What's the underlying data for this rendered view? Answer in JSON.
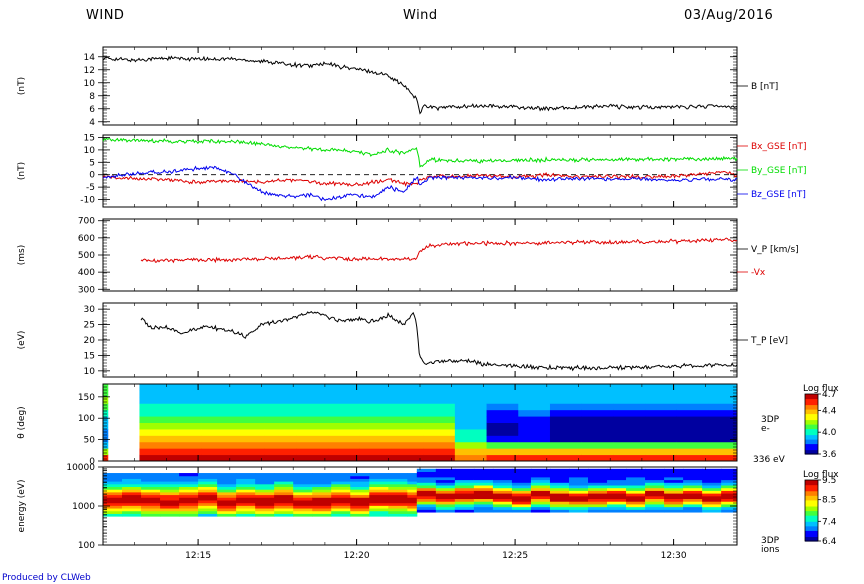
{
  "header": {
    "left": "WIND",
    "center": "Wind",
    "right": "03/Aug/2016"
  },
  "footer": {
    "credit": "Produced by CLWeb"
  },
  "colors": {
    "black": "#000000",
    "red": "#dd0000",
    "green": "#00dd00",
    "blue": "#0000ee",
    "spectrogram_scale": [
      "#0000a0",
      "#0000ff",
      "#0080ff",
      "#00c0ff",
      "#00ffc0",
      "#40ff40",
      "#a0ff00",
      "#ffff00",
      "#ffc000",
      "#ff8000",
      "#ff2000",
      "#c00000"
    ]
  },
  "chart_data": [
    {
      "type": "line",
      "ylabel": "(nT)",
      "ylim": [
        3.5,
        15.5
      ],
      "yticks": [
        4,
        6,
        8,
        10,
        12,
        14
      ],
      "series": [
        {
          "name": "B [nT]",
          "color": "#000000",
          "x": [
            12.0,
            12.5,
            13.0,
            14.0,
            15.0,
            16.0,
            17.0,
            17.5,
            18.0,
            18.5,
            19.0,
            19.5,
            20.0,
            20.5,
            21.0,
            21.5,
            21.9,
            22.0,
            22.1,
            22.3,
            22.6,
            23.0,
            24.0,
            25.0,
            26.0,
            27.0,
            28.0,
            29.0,
            30.0,
            31.0,
            32.0
          ],
          "y": [
            13.8,
            13.6,
            13.5,
            13.8,
            13.6,
            13.7,
            13.3,
            13.1,
            12.8,
            12.6,
            12.9,
            12.5,
            12.1,
            11.6,
            11.2,
            9.5,
            7.5,
            5.2,
            6.6,
            6.3,
            6.1,
            6.3,
            6.4,
            6.3,
            6.0,
            6.2,
            6.4,
            6.2,
            6.3,
            6.4,
            6.4
          ]
        }
      ],
      "legend": [
        {
          "label": "B [nT]",
          "color": "#000000"
        }
      ]
    },
    {
      "type": "line",
      "ylabel": "(nT)",
      "ylim": [
        -13,
        16
      ],
      "yticks": [
        -10,
        -5,
        0,
        5,
        10,
        15
      ],
      "zero_line": 0,
      "series": [
        {
          "name": "Bx_GSE [nT]",
          "color": "#dd0000",
          "x": [
            12.0,
            13.0,
            14.0,
            15.0,
            16.0,
            17.0,
            18.0,
            19.0,
            20.0,
            20.5,
            21.0,
            21.5,
            21.9,
            22.0,
            22.3,
            23.0,
            24.0,
            25.0,
            26.0,
            27.0,
            28.0,
            29.0,
            30.0,
            31.0,
            31.6,
            32.0
          ],
          "y": [
            -1,
            -1.5,
            -2,
            -3,
            -2.5,
            -3,
            -2,
            -3.5,
            -4,
            -3,
            -2,
            -3.5,
            -4,
            -2,
            -1,
            -0.5,
            -0.5,
            -0.8,
            0,
            -1,
            -0.5,
            -0.8,
            -0.5,
            0.5,
            1.5,
            -0.5
          ]
        },
        {
          "name": "By_GSE [nT]",
          "color": "#00dd00",
          "x": [
            12.0,
            13.0,
            14.0,
            15.0,
            16.0,
            16.5,
            17.0,
            17.5,
            18.0,
            18.5,
            19.0,
            19.5,
            20.0,
            20.5,
            21.0,
            21.5,
            21.9,
            22.0,
            22.3,
            23.0,
            24.0,
            25.0,
            26.0,
            27.0,
            28.0,
            29.0,
            30.0,
            31.0,
            32.0
          ],
          "y": [
            14,
            14,
            13.5,
            13.5,
            13.5,
            13,
            12.5,
            11.5,
            11,
            10.5,
            10,
            10,
            9.5,
            8,
            10,
            8.5,
            11,
            3.5,
            6,
            5.5,
            5.5,
            5.8,
            6,
            6,
            6,
            6.2,
            6.3,
            6.4,
            6.5
          ]
        },
        {
          "name": "Bz_GSE [nT]",
          "color": "#0000ee",
          "x": [
            12.0,
            13.0,
            14.0,
            15.0,
            15.5,
            16.0,
            16.5,
            17.0,
            17.5,
            18.0,
            18.5,
            19.0,
            19.5,
            20.0,
            20.5,
            21.0,
            21.5,
            21.9,
            22.0,
            22.3,
            23.0,
            24.0,
            25.0,
            26.0,
            27.0,
            28.0,
            29.0,
            30.0,
            31.0,
            32.0
          ],
          "y": [
            -1,
            0.5,
            1,
            2.5,
            3,
            1,
            -3,
            -7,
            -8,
            -9,
            -8,
            -10,
            -9,
            -8,
            -9,
            -5,
            -7,
            -1,
            -4,
            -1.5,
            -1,
            -1.5,
            -1,
            -2,
            -1.5,
            -2,
            -1.5,
            -2.5,
            -1.5,
            -2
          ]
        }
      ],
      "legend": [
        {
          "label": "Bx_GSE [nT]",
          "color": "#dd0000"
        },
        {
          "label": "By_GSE [nT]",
          "color": "#00dd00"
        },
        {
          "label": "Bz_GSE [nT]",
          "color": "#0000ee"
        }
      ]
    },
    {
      "type": "line",
      "ylabel": "(ms)",
      "ylim": [
        290,
        710
      ],
      "yticks": [
        300,
        400,
        500,
        600,
        700
      ],
      "series": [
        {
          "name": "V_P [km/s]",
          "color": "#dd0000",
          "x": [
            13.2,
            14.0,
            15.0,
            16.0,
            17.0,
            18.0,
            18.5,
            19.0,
            20.0,
            21.0,
            21.9,
            22.0,
            22.3,
            23.0,
            24.0,
            25.0,
            26.0,
            27.0,
            28.0,
            29.0,
            30.0,
            31.0,
            31.6,
            32.0
          ],
          "y": [
            467,
            468,
            470,
            472,
            478,
            482,
            490,
            480,
            476,
            478,
            476,
            520,
            555,
            565,
            568,
            568,
            570,
            575,
            572,
            578,
            580,
            584,
            590,
            585
          ]
        }
      ],
      "legend": [
        {
          "label": "V_P [km/s]",
          "color": "#000000"
        },
        {
          "label": "-Vx",
          "color": "#dd0000"
        }
      ]
    },
    {
      "type": "line",
      "ylabel": "(eV)",
      "ylim": [
        8,
        32
      ],
      "yticks": [
        10,
        15,
        20,
        25,
        30
      ],
      "series": [
        {
          "name": "T_P [eV]",
          "color": "#000000",
          "x": [
            13.2,
            13.5,
            14.0,
            14.5,
            15.0,
            15.5,
            16.0,
            16.5,
            17.0,
            17.5,
            18.0,
            18.5,
            19.0,
            19.5,
            20.0,
            20.5,
            21.0,
            21.5,
            21.8,
            21.9,
            22.0,
            22.2,
            22.5,
            23.0,
            23.5,
            24.0,
            25.0,
            26.0,
            27.0,
            28.0,
            29.0,
            30.0,
            31.0,
            32.0
          ],
          "y": [
            27,
            24,
            24,
            22,
            24,
            24,
            23,
            21,
            25,
            26,
            27,
            29,
            28,
            26,
            27,
            26,
            28,
            25,
            29,
            24,
            14,
            12,
            13,
            13,
            13.5,
            12,
            11.5,
            11,
            11,
            11,
            11.2,
            11.5,
            11.8,
            11.8
          ]
        }
      ],
      "legend": [
        {
          "label": "T_P [eV]",
          "color": "#000000"
        }
      ]
    },
    {
      "type": "heatmap",
      "ylabel": "θ (deg)",
      "ylim": [
        0,
        180
      ],
      "yticks": [
        0,
        50,
        100,
        150
      ],
      "y_bins": [
        0,
        15,
        30,
        45,
        60,
        75,
        90,
        105,
        120,
        135,
        150,
        165,
        180
      ],
      "time_edges": [
        12.0,
        12.15,
        12.45,
        13.15,
        14.1,
        15.1,
        16.1,
        17.1,
        18.1,
        19.1,
        20.1,
        21.1,
        22.1,
        23.1,
        24.1,
        25.1,
        26.1,
        27.1,
        28.1,
        29.1,
        30.1,
        31.1,
        32.0
      ],
      "z": [
        [
          4.6,
          4.2,
          3.92,
          3.8,
          3.82,
          3.88,
          3.95,
          4.02,
          4.1,
          4.15,
          4.12,
          4.08
        ],
        [
          null,
          null,
          null,
          null,
          null,
          null,
          null,
          null,
          null,
          null,
          null,
          null
        ],
        [
          null,
          null,
          null,
          null,
          null,
          null,
          null,
          null,
          null,
          null,
          null,
          null
        ],
        [
          4.65,
          4.55,
          4.45,
          4.35,
          4.25,
          4.15,
          4.08,
          4.02,
          3.97,
          3.95,
          3.93,
          3.92
        ],
        [
          4.65,
          4.55,
          4.45,
          4.35,
          4.25,
          4.15,
          4.08,
          4.02,
          3.97,
          3.95,
          3.93,
          3.92
        ],
        [
          4.68,
          4.57,
          4.47,
          4.36,
          4.26,
          4.16,
          4.08,
          4.02,
          3.97,
          3.94,
          3.92,
          3.92
        ],
        [
          4.68,
          4.57,
          4.47,
          4.36,
          4.26,
          4.16,
          4.08,
          4.02,
          3.97,
          3.94,
          3.92,
          3.92
        ],
        [
          4.68,
          4.57,
          4.47,
          4.36,
          4.26,
          4.16,
          4.08,
          4.02,
          3.97,
          3.94,
          3.92,
          3.92
        ],
        [
          4.68,
          4.57,
          4.47,
          4.36,
          4.26,
          4.16,
          4.08,
          4.02,
          3.97,
          3.94,
          3.92,
          3.92
        ],
        [
          4.68,
          4.57,
          4.47,
          4.36,
          4.26,
          4.16,
          4.08,
          4.02,
          3.97,
          3.94,
          3.92,
          3.92
        ],
        [
          4.68,
          4.57,
          4.47,
          4.36,
          4.26,
          4.16,
          4.08,
          4.02,
          3.97,
          3.94,
          3.92,
          3.92
        ],
        [
          4.68,
          4.57,
          4.47,
          4.36,
          4.26,
          4.16,
          4.08,
          4.02,
          3.97,
          3.94,
          3.92,
          3.92
        ],
        [
          4.68,
          4.57,
          4.47,
          4.36,
          4.26,
          4.16,
          4.08,
          4.02,
          3.97,
          3.94,
          3.92,
          3.92
        ],
        [
          4.45,
          4.35,
          4.2,
          4.05,
          3.98,
          3.95,
          3.93,
          3.92,
          3.92,
          3.92,
          3.92,
          3.92
        ],
        [
          4.6,
          4.35,
          4.1,
          3.7,
          3.65,
          3.66,
          3.7,
          3.75,
          3.85,
          3.9,
          3.92,
          3.92
        ],
        [
          4.6,
          4.35,
          4.1,
          3.75,
          3.72,
          3.72,
          3.75,
          3.8,
          3.88,
          3.92,
          3.93,
          3.92
        ],
        [
          4.6,
          4.35,
          4.1,
          3.66,
          3.62,
          3.62,
          3.66,
          3.72,
          3.85,
          3.9,
          3.92,
          3.92
        ],
        [
          4.6,
          4.35,
          4.1,
          3.66,
          3.62,
          3.62,
          3.66,
          3.72,
          3.85,
          3.9,
          3.92,
          3.92
        ],
        [
          4.6,
          4.35,
          4.1,
          3.66,
          3.62,
          3.62,
          3.66,
          3.72,
          3.85,
          3.9,
          3.92,
          3.92
        ],
        [
          4.6,
          4.35,
          4.1,
          3.66,
          3.62,
          3.62,
          3.66,
          3.72,
          3.85,
          3.9,
          3.92,
          3.92
        ],
        [
          4.6,
          4.35,
          4.1,
          3.66,
          3.62,
          3.62,
          3.66,
          3.72,
          3.85,
          3.9,
          3.92,
          3.92
        ],
        [
          4.6,
          4.35,
          4.1,
          3.66,
          3.62,
          3.62,
          3.66,
          3.72,
          3.85,
          3.9,
          3.92,
          3.92
        ]
      ],
      "side_labels": [
        "3DP",
        "e-",
        "336 eV"
      ],
      "colorbar": {
        "title": "Log flux",
        "range": [
          3.6,
          4.7
        ],
        "ticks": [
          3.6,
          4.0,
          4.4,
          4.7
        ],
        "tick_labels": [
          "3.6",
          "4.0",
          "4.4",
          "4.7"
        ]
      }
    },
    {
      "type": "heatmap",
      "ylabel": "energy (eV)",
      "ylog": true,
      "ylim": [
        100,
        10000
      ],
      "yticks": [
        100,
        1000,
        10000
      ],
      "colorbar": {
        "title": "Log flux",
        "range": [
          6.4,
          9.5
        ],
        "ticks": [
          6.4,
          7.4,
          8.5,
          9.5
        ],
        "tick_labels": [
          "6.4",
          "7.4",
          "8.5",
          "9.5"
        ]
      },
      "side_labels": [
        "3DP",
        "ions"
      ],
      "pre": {
        "x_range": [
          12.0,
          21.9
        ],
        "center_log_energy": 3.15,
        "width": 0.5,
        "peak": 9.4,
        "floor": 6.9,
        "e_min": 550,
        "e_max": 7000
      },
      "post": {
        "x_range": [
          21.9,
          32.0
        ],
        "center_log_energy": 3.25,
        "width": 0.35,
        "peak": 9.5,
        "floor": 6.8,
        "e_min": 700,
        "e_max": 9000
      }
    }
  ],
  "time_axis": {
    "range": [
      12.0,
      32.0
    ],
    "ticks": [
      15,
      20,
      25,
      30
    ],
    "tick_labels": [
      "12:15",
      "12:20",
      "12:25",
      "12:30"
    ]
  }
}
